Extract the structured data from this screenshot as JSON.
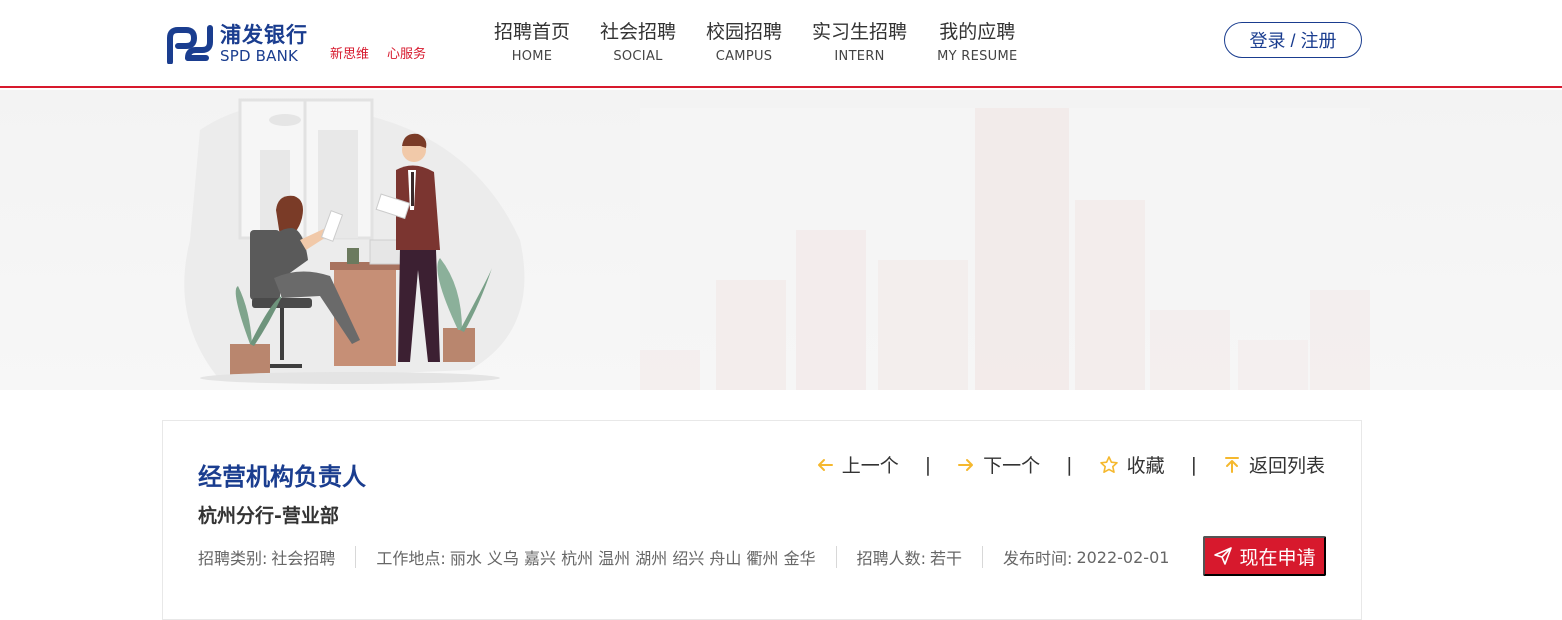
{
  "header": {
    "logo": {
      "cn": "浦发银行",
      "en": "SPD BANK",
      "slogan_1": "新思维",
      "slogan_2": "心服务"
    },
    "nav": [
      {
        "cn": "招聘首页",
        "en": "HOME"
      },
      {
        "cn": "社会招聘",
        "en": "SOCIAL"
      },
      {
        "cn": "校园招聘",
        "en": "CAMPUS"
      },
      {
        "cn": "实习生招聘",
        "en": "INTERN"
      },
      {
        "cn": "我的应聘",
        "en": "MY RESUME"
      }
    ],
    "login_label": "登录 / 注册"
  },
  "job": {
    "title": "经营机构负责人",
    "department": "杭州分行-营业部",
    "actions": {
      "prev": "上一个",
      "next": "下一个",
      "favorite": "收藏",
      "back": "返回列表",
      "separator": "|"
    },
    "meta": {
      "category_key": "招聘类别:",
      "category_val": "社会招聘",
      "location_key": "工作地点:",
      "location_val": "丽水 义乌 嘉兴 杭州 温州 湖州 绍兴 舟山 衢州 金华",
      "count_key": "招聘人数:",
      "count_val": "若干",
      "date_key": "发布时间:",
      "date_val": "2022-02-01"
    },
    "apply_label": "现在申请"
  },
  "colors": {
    "brand_blue": "#1a3d8f",
    "brand_red": "#d7192d",
    "accent_yellow": "#f5b82e"
  }
}
